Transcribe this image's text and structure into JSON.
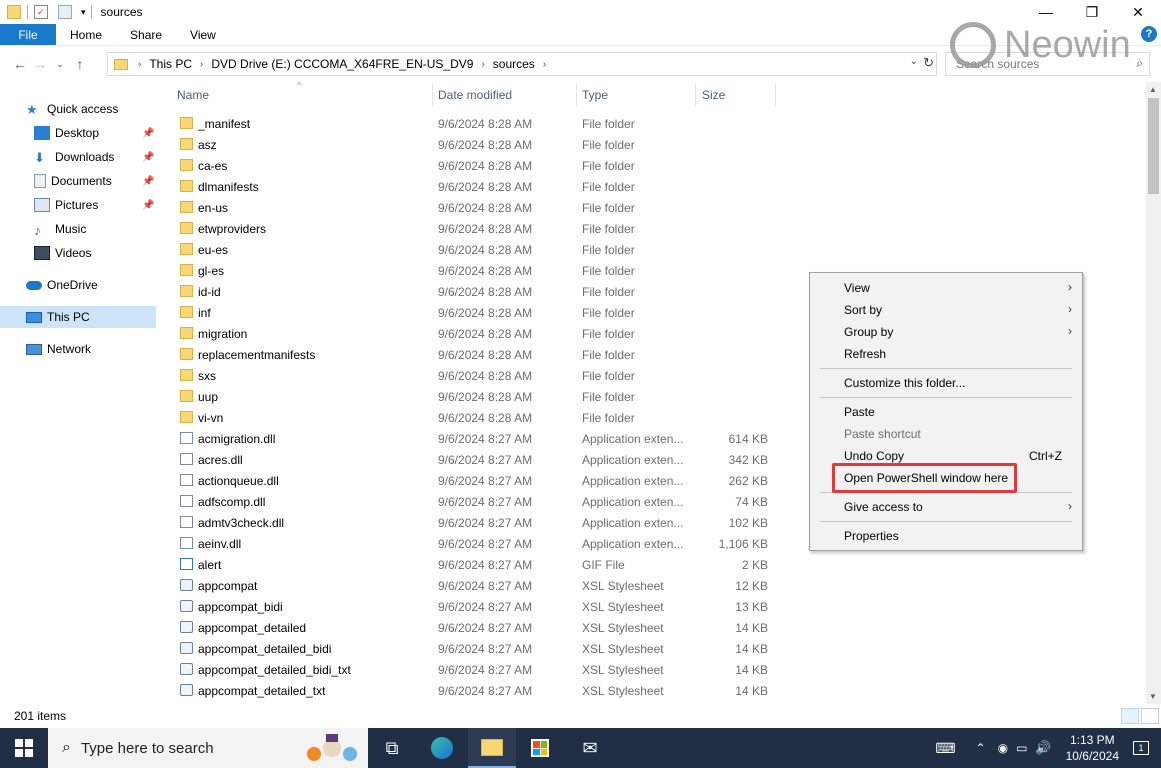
{
  "window": {
    "title": "sources"
  },
  "ribbon": {
    "file": "File",
    "tabs": [
      "Home",
      "Share",
      "View"
    ],
    "help": "?"
  },
  "address": {
    "crumbs": [
      "This PC",
      "DVD Drive (E:) CCCOMA_X64FRE_EN-US_DV9",
      "sources"
    ],
    "search_placeholder": "Search sources"
  },
  "watermark": "Neowin",
  "nav": {
    "quick_access": "Quick access",
    "items": [
      "Desktop",
      "Downloads",
      "Documents",
      "Pictures",
      "Music",
      "Videos"
    ],
    "onedrive": "OneDrive",
    "thispc": "This PC",
    "network": "Network"
  },
  "columns": {
    "name": "Name",
    "date": "Date modified",
    "type": "Type",
    "size": "Size"
  },
  "files": [
    {
      "name": "_manifest",
      "date": "9/6/2024 8:28 AM",
      "type": "File folder",
      "size": "",
      "kind": "folder"
    },
    {
      "name": "asz",
      "date": "9/6/2024 8:28 AM",
      "type": "File folder",
      "size": "",
      "kind": "folder"
    },
    {
      "name": "ca-es",
      "date": "9/6/2024 8:28 AM",
      "type": "File folder",
      "size": "",
      "kind": "folder"
    },
    {
      "name": "dlmanifests",
      "date": "9/6/2024 8:28 AM",
      "type": "File folder",
      "size": "",
      "kind": "folder"
    },
    {
      "name": "en-us",
      "date": "9/6/2024 8:28 AM",
      "type": "File folder",
      "size": "",
      "kind": "folder"
    },
    {
      "name": "etwproviders",
      "date": "9/6/2024 8:28 AM",
      "type": "File folder",
      "size": "",
      "kind": "folder"
    },
    {
      "name": "eu-es",
      "date": "9/6/2024 8:28 AM",
      "type": "File folder",
      "size": "",
      "kind": "folder"
    },
    {
      "name": "gl-es",
      "date": "9/6/2024 8:28 AM",
      "type": "File folder",
      "size": "",
      "kind": "folder"
    },
    {
      "name": "id-id",
      "date": "9/6/2024 8:28 AM",
      "type": "File folder",
      "size": "",
      "kind": "folder"
    },
    {
      "name": "inf",
      "date": "9/6/2024 8:28 AM",
      "type": "File folder",
      "size": "",
      "kind": "folder"
    },
    {
      "name": "migration",
      "date": "9/6/2024 8:28 AM",
      "type": "File folder",
      "size": "",
      "kind": "folder"
    },
    {
      "name": "replacementmanifests",
      "date": "9/6/2024 8:28 AM",
      "type": "File folder",
      "size": "",
      "kind": "folder"
    },
    {
      "name": "sxs",
      "date": "9/6/2024 8:28 AM",
      "type": "File folder",
      "size": "",
      "kind": "folder"
    },
    {
      "name": "uup",
      "date": "9/6/2024 8:28 AM",
      "type": "File folder",
      "size": "",
      "kind": "folder"
    },
    {
      "name": "vi-vn",
      "date": "9/6/2024 8:28 AM",
      "type": "File folder",
      "size": "",
      "kind": "folder"
    },
    {
      "name": "acmigration.dll",
      "date": "9/6/2024 8:27 AM",
      "type": "Application exten...",
      "size": "614 KB",
      "kind": "dll"
    },
    {
      "name": "acres.dll",
      "date": "9/6/2024 8:27 AM",
      "type": "Application exten...",
      "size": "342 KB",
      "kind": "dll"
    },
    {
      "name": "actionqueue.dll",
      "date": "9/6/2024 8:27 AM",
      "type": "Application exten...",
      "size": "262 KB",
      "kind": "dll"
    },
    {
      "name": "adfscomp.dll",
      "date": "9/6/2024 8:27 AM",
      "type": "Application exten...",
      "size": "74 KB",
      "kind": "dll"
    },
    {
      "name": "admtv3check.dll",
      "date": "9/6/2024 8:27 AM",
      "type": "Application exten...",
      "size": "102 KB",
      "kind": "dll"
    },
    {
      "name": "aeinv.dll",
      "date": "9/6/2024 8:27 AM",
      "type": "Application exten...",
      "size": "1,106 KB",
      "kind": "dll"
    },
    {
      "name": "alert",
      "date": "9/6/2024 8:27 AM",
      "type": "GIF File",
      "size": "2 KB",
      "kind": "gif"
    },
    {
      "name": "appcompat",
      "date": "9/6/2024 8:27 AM",
      "type": "XSL Stylesheet",
      "size": "12 KB",
      "kind": "xsl"
    },
    {
      "name": "appcompat_bidi",
      "date": "9/6/2024 8:27 AM",
      "type": "XSL Stylesheet",
      "size": "13 KB",
      "kind": "xsl"
    },
    {
      "name": "appcompat_detailed",
      "date": "9/6/2024 8:27 AM",
      "type": "XSL Stylesheet",
      "size": "14 KB",
      "kind": "xsl"
    },
    {
      "name": "appcompat_detailed_bidi",
      "date": "9/6/2024 8:27 AM",
      "type": "XSL Stylesheet",
      "size": "14 KB",
      "kind": "xsl"
    },
    {
      "name": "appcompat_detailed_bidi_txt",
      "date": "9/6/2024 8:27 AM",
      "type": "XSL Stylesheet",
      "size": "14 KB",
      "kind": "xsl"
    },
    {
      "name": "appcompat_detailed_txt",
      "date": "9/6/2024 8:27 AM",
      "type": "XSL Stylesheet",
      "size": "14 KB",
      "kind": "xsl"
    }
  ],
  "status": {
    "count": "201 items"
  },
  "context_menu": {
    "view": "View",
    "sort_by": "Sort by",
    "group_by": "Group by",
    "refresh": "Refresh",
    "customize": "Customize this folder...",
    "paste": "Paste",
    "paste_shortcut": "Paste shortcut",
    "undo_copy": "Undo Copy",
    "undo_shortcut": "Ctrl+Z",
    "powershell": "Open PowerShell window here",
    "give_access": "Give access to",
    "properties": "Properties"
  },
  "taskbar": {
    "search_placeholder": "Type here to search",
    "time": "1:13 PM",
    "date": "10/6/2024",
    "notifications": "1"
  },
  "colors": {
    "accent": "#1979ca",
    "highlight": "#e03b3b",
    "taskbar": "#202f45"
  }
}
